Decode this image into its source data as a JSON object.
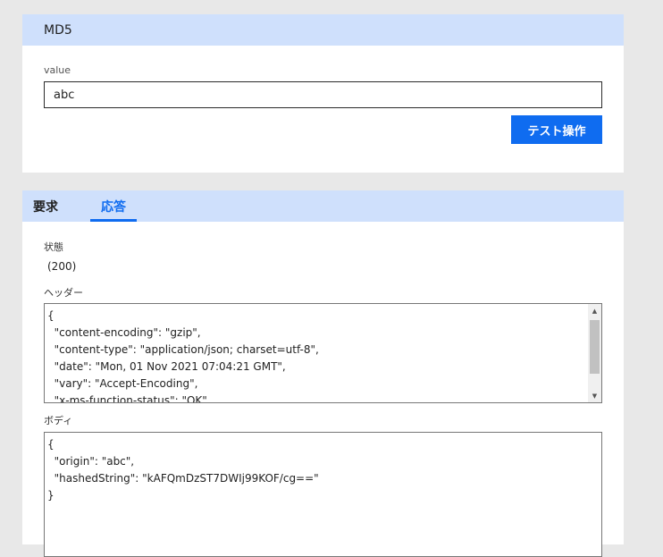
{
  "action": {
    "title": "MD5",
    "value_label": "value",
    "value": "abc",
    "test_button_label": "テスト操作"
  },
  "result": {
    "tabs": [
      {
        "label": "要求",
        "active": false
      },
      {
        "label": "応答",
        "active": true
      }
    ],
    "status_label": "状態",
    "status_value": "(200)",
    "headers_label": "ヘッダー",
    "headers_text": "{\n  \"content-encoding\": \"gzip\",\n  \"content-type\": \"application/json; charset=utf-8\",\n  \"date\": \"Mon, 01 Nov 2021 07:04:21 GMT\",\n  \"vary\": \"Accept-Encoding\",\n  \"x-ms-function-status\": \"OK\"\n}",
    "body_label": "ボディ",
    "body_text": "{\n  \"origin\": \"abc\",\n  \"hashedString\": \"kAFQmDzST7DWIj99KOF/cg==\"\n}"
  },
  "colors": {
    "accent": "#0f6cf0",
    "header_bg": "#cfe0fc",
    "page_bg": "#e8e8e8"
  }
}
